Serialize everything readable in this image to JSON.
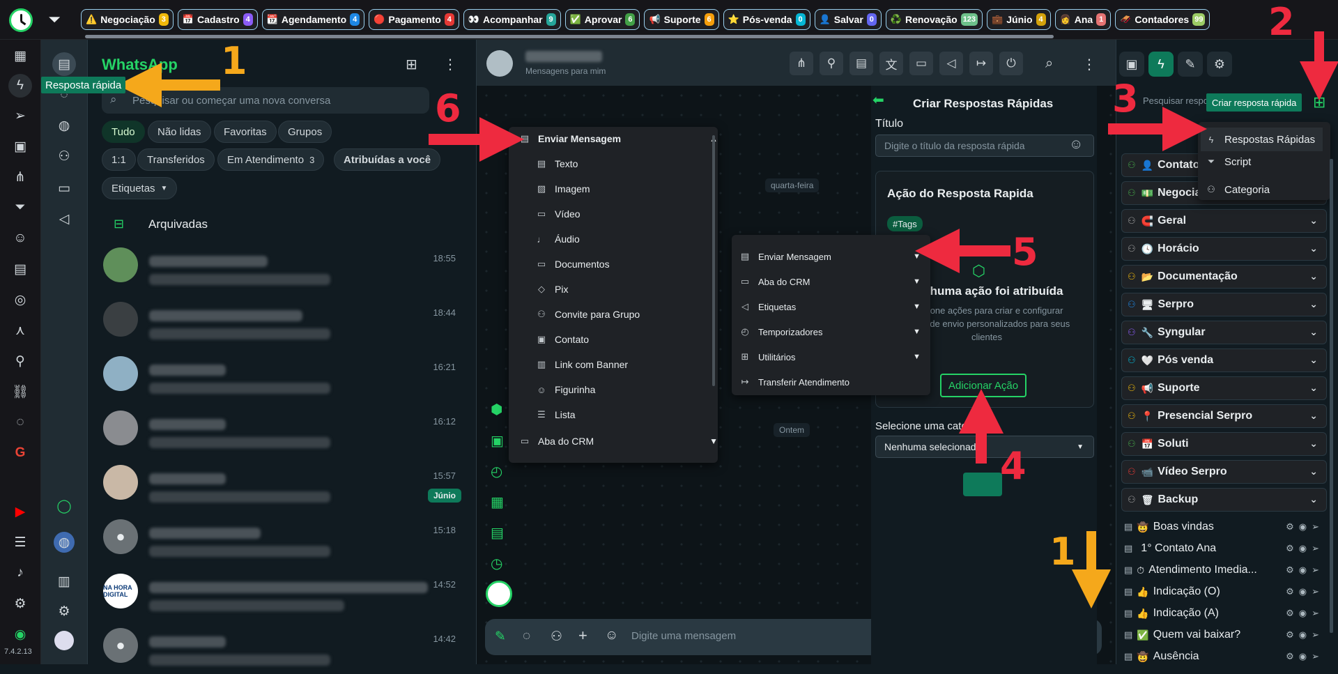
{
  "topbar": {
    "tags": [
      {
        "icon": "⚠️",
        "label": "Negociação",
        "count": "3",
        "color": "#f0b90b"
      },
      {
        "icon": "📅",
        "label": "Cadastro",
        "count": "4",
        "color": "#8b5cf6"
      },
      {
        "icon": "📆",
        "label": "Agendamento",
        "count": "4",
        "color": "#1e88e5"
      },
      {
        "icon": "🔴",
        "label": "Pagamento",
        "count": "4",
        "color": "#e53935"
      },
      {
        "icon": "👀",
        "label": "Acompanhar",
        "count": "9",
        "color": "#26a69a"
      },
      {
        "icon": "✅",
        "label": "Aprovar",
        "count": "6",
        "color": "#43a047"
      },
      {
        "icon": "📢",
        "label": "Suporte",
        "count": "6",
        "color": "#f59e0b"
      },
      {
        "icon": "⭐",
        "label": "Pós-venda",
        "count": "0",
        "color": "#06b6d4"
      },
      {
        "icon": "👤",
        "label": "Salvar",
        "count": "0",
        "color": "#6366f1"
      },
      {
        "icon": "♻️",
        "label": "Renovação",
        "count": "123",
        "color": "#6ec18a"
      },
      {
        "icon": "💼",
        "label": "Júnio",
        "count": "4",
        "color": "#d4a20b"
      },
      {
        "icon": "👩",
        "label": "Ana",
        "count": "1",
        "color": "#e57373"
      },
      {
        "icon": "🛷",
        "label": "Contadores",
        "count": "99",
        "color": "#9ccc65"
      }
    ]
  },
  "rail": {
    "tooltip": "Resposta rápida",
    "version": "7.4.2.13"
  },
  "chatlist": {
    "title": "WhatsApp",
    "search_placeholder": "Pesquisar ou começar uma nova conversa",
    "filters": [
      "Tudo",
      "Não lidas",
      "Favoritas",
      "Grupos"
    ],
    "filters2": [
      "1:1",
      "Transferidos",
      "Em Atendimento",
      "Atribuídas a você"
    ],
    "em_atendimento_count": "3",
    "labels_dropdown": "Etiquetas",
    "archived": "Arquivadas",
    "chats": [
      {
        "time": "18:55",
        "label": ""
      },
      {
        "time": "18:44",
        "label": ""
      },
      {
        "time": "16:21",
        "label": ""
      },
      {
        "time": "16:12",
        "label": ""
      },
      {
        "time": "15:57",
        "label": "Júnio"
      },
      {
        "time": "15:18",
        "label": ""
      },
      {
        "time": "14:52",
        "label": ""
      },
      {
        "time": "14:42",
        "label": ""
      }
    ],
    "logo_text": "NA HORA DIGITAL"
  },
  "chat": {
    "status": "Mensagens para mim",
    "day1": "quarta-feira",
    "day2": "Ontem",
    "composer_placeholder": "Digite uma mensagem"
  },
  "menu_send": {
    "header": "Enviar Mensagem",
    "items": [
      "Texto",
      "Imagem",
      "Vídeo",
      "Áudio",
      "Documentos",
      "Pix",
      "Convite para Grupo",
      "Contato",
      "Link com Banner",
      "Figurinha",
      "Lista"
    ],
    "footer": "Aba do CRM"
  },
  "menu_actions": {
    "items": [
      "Enviar Mensagem",
      "Aba do CRM",
      "Etiquetas",
      "Temporizadores",
      "Utilitários",
      "Transferir Atendimento"
    ]
  },
  "create_panel": {
    "title": "Criar Respostas Rápidas",
    "title_label": "Título",
    "title_placeholder": "Digite o título da resposta rápida",
    "action_title": "Ação do Resposta Rapida",
    "tags_chip": "#Tags",
    "no_action": "Nenhuma ação foi atribuída",
    "no_action_hint": "Adicione ações para criar e configurar fluxos de envio personalizados para seus clientes",
    "add_action": "Adicionar Ação",
    "category_label": "Selecione uma categoria",
    "category_value": "Nenhuma selecionada"
  },
  "right": {
    "search_placeholder": "Pesquisar respostas",
    "create_tooltip": "Criar resposta rápida",
    "dropdown": [
      "Respostas Rápidas",
      "Script",
      "Categoria"
    ],
    "categories": [
      {
        "icon": "👤",
        "label": "Contato",
        "tri": "#43a047"
      },
      {
        "icon": "💵",
        "label": "Negociação",
        "tri": "#43a047"
      },
      {
        "icon": "🧲",
        "label": "Geral",
        "tri": "#9e9e9e"
      },
      {
        "icon": "🕓",
        "label": "Horácio",
        "tri": "#9e9e9e"
      },
      {
        "icon": "📂",
        "label": "Documentação",
        "tri": "#f0b90b"
      },
      {
        "icon": "🖥",
        "label": "Serpro",
        "tri": "#1e88e5"
      },
      {
        "icon": "🔧",
        "label": "Syngular",
        "tri": "#8b5cf6"
      },
      {
        "icon": "🤍",
        "label": "Pós venda",
        "tri": "#06b6d4"
      },
      {
        "icon": "📢",
        "label": "Suporte",
        "tri": "#f0b90b"
      },
      {
        "icon": "📍",
        "label": "Presencial Serpro",
        "tri": "#f0b90b"
      },
      {
        "icon": "📅",
        "label": "Soluti",
        "tri": "#43a047"
      },
      {
        "icon": "📹",
        "label": "Vídeo Serpro",
        "tri": "#e53935"
      },
      {
        "icon": "🗑",
        "label": "Backup",
        "tri": "#9e9e9e"
      }
    ],
    "quick_replies": [
      {
        "icon": "🤠",
        "label": "Boas vindas"
      },
      {
        "icon": "",
        "label": "1° Contato Ana"
      },
      {
        "icon": "⏱",
        "label": "Atendimento Imedia..."
      },
      {
        "icon": "👍",
        "label": "Indicação (O)"
      },
      {
        "icon": "👍",
        "label": "Indicação (A)"
      },
      {
        "icon": "✅",
        "label": "Quem vai baixar?"
      },
      {
        "icon": "🤠",
        "label": "Ausência"
      }
    ]
  },
  "annotations": [
    "1",
    "2",
    "3",
    "4",
    "5",
    "6",
    "1"
  ]
}
